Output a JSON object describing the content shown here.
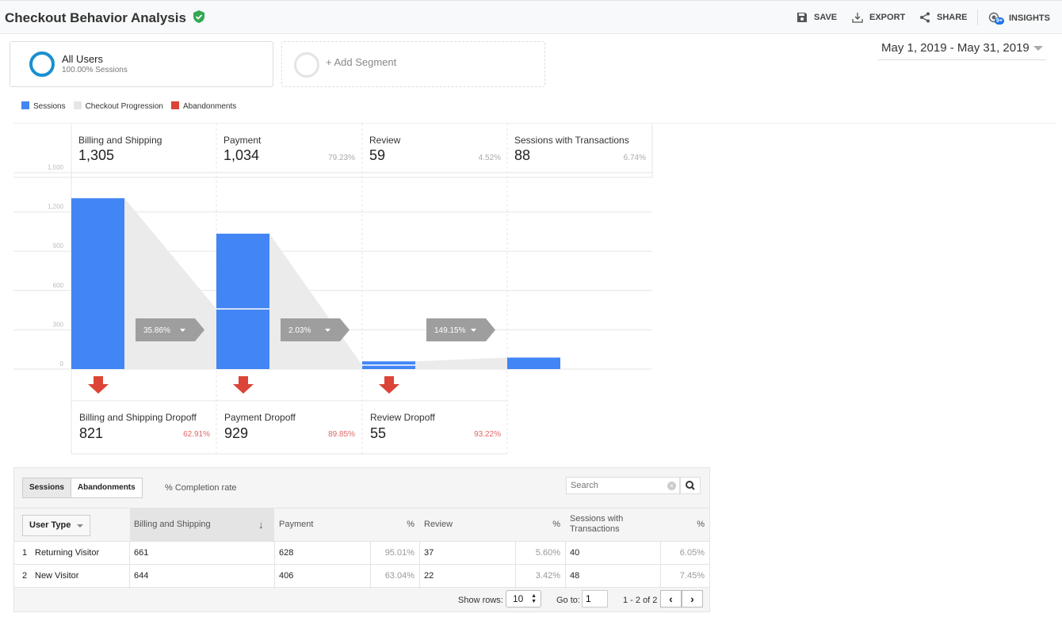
{
  "header": {
    "title": "Checkout Behavior Analysis",
    "save": "SAVE",
    "export": "EXPORT",
    "share": "SHARE",
    "insights": "INSIGHTS",
    "insights_badge": "9+"
  },
  "segments": {
    "all_users": "All Users",
    "all_users_sub": "100.00% Sessions",
    "add": "+ Add Segment"
  },
  "date_range": "May 1, 2019 - May 31, 2019",
  "legend": [
    {
      "label": "Sessions",
      "color": "#4285f4"
    },
    {
      "label": "Checkout Progression",
      "color": "#e6e6e6"
    },
    {
      "label": "Abandonments",
      "color": "#db4437"
    }
  ],
  "chart_data": {
    "type": "bar",
    "categories": [
      "Billing and Shipping",
      "Payment",
      "Review",
      "Sessions with Transactions"
    ],
    "values": [
      1305,
      1034,
      59,
      88
    ],
    "percents": [
      "",
      "79.23%",
      "4.52%",
      "6.74%"
    ],
    "values_label": [
      "1,305",
      "1,034",
      "59",
      "88"
    ],
    "progressed": [
      null,
      460,
      30,
      88
    ],
    "ylim": [
      0,
      1500
    ],
    "yticks": [
      "0",
      "300",
      "600",
      "900",
      "1,200",
      "1,500"
    ],
    "progress_rates": [
      "35.86%",
      "2.03%",
      "149.15%"
    ],
    "dropoffs": [
      {
        "label": "Billing and Shipping Dropoff",
        "value": "821",
        "pct": "62.91%"
      },
      {
        "label": "Payment Dropoff",
        "value": "929",
        "pct": "89.85%"
      },
      {
        "label": "Review Dropoff",
        "value": "55",
        "pct": "93.22%"
      }
    ]
  },
  "table": {
    "tabs": [
      "Sessions",
      "Abandonments"
    ],
    "completion": "% Completion rate",
    "search_placeholder": "Search",
    "dim": "User Type",
    "headers": [
      "Billing and Shipping",
      "Payment",
      "%",
      "Review",
      "%",
      "Sessions with Transactions",
      "%"
    ],
    "rows": [
      {
        "n": "1",
        "name": "Returning Visitor",
        "c": [
          "661",
          "628",
          "95.01%",
          "37",
          "5.60%",
          "40",
          "6.05%"
        ]
      },
      {
        "n": "2",
        "name": "New Visitor",
        "c": [
          "644",
          "406",
          "63.04%",
          "22",
          "3.42%",
          "48",
          "7.45%"
        ]
      }
    ],
    "show_rows_label": "Show rows:",
    "show_rows": "10",
    "goto_label": "Go to:",
    "goto": "1",
    "range": "1 - 2 of 2"
  }
}
